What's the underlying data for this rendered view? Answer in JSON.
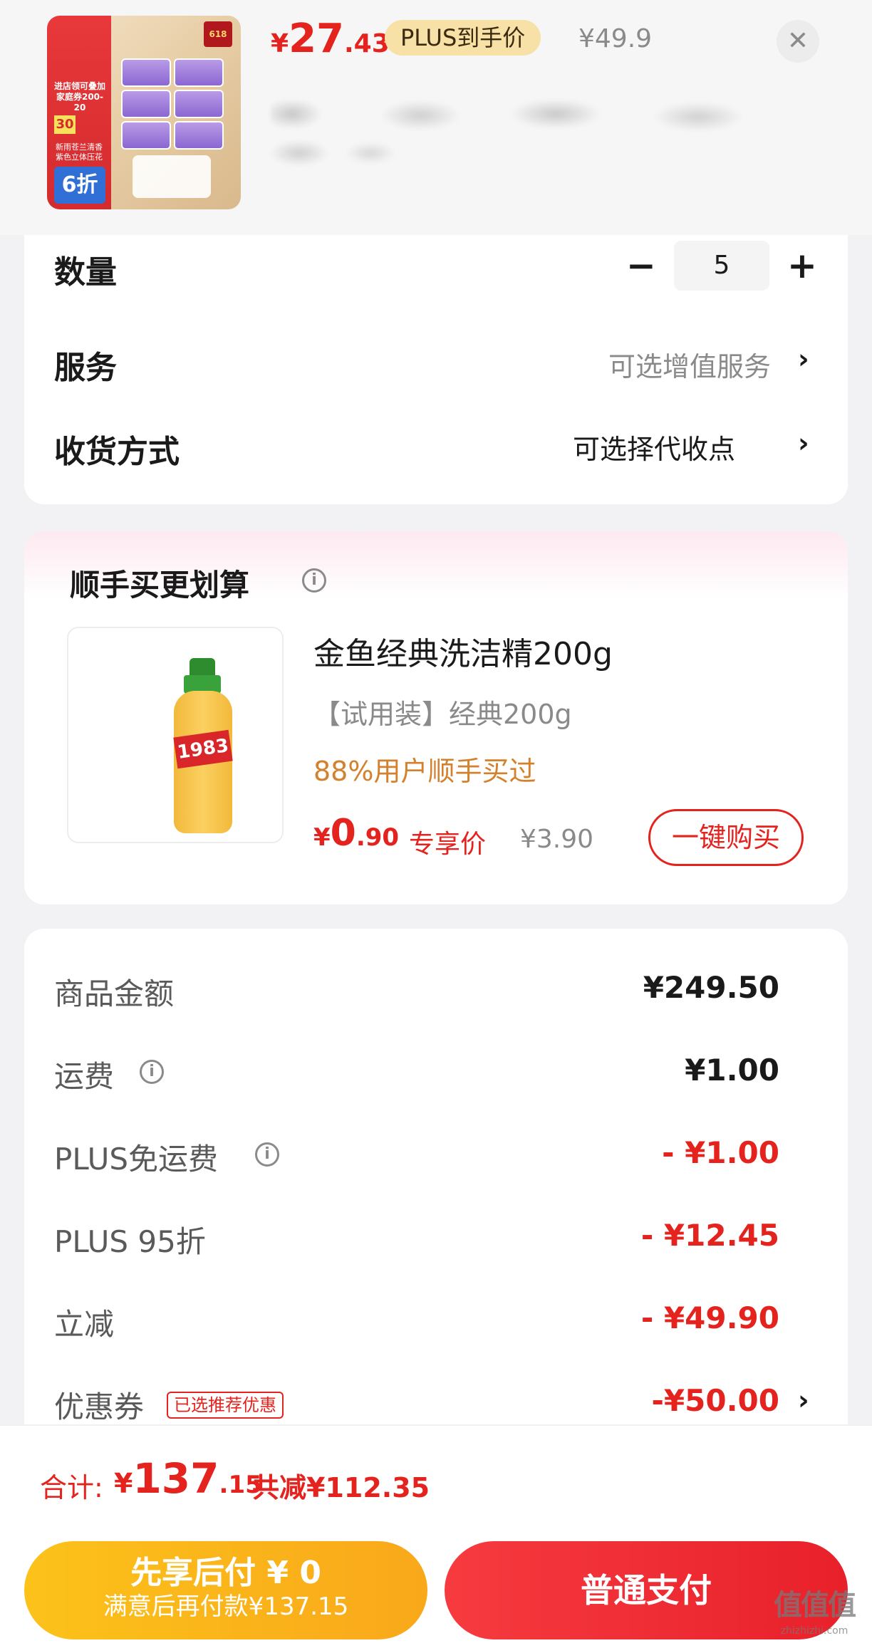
{
  "product": {
    "price_currency": "¥",
    "price_int": "27",
    "price_dec": ".43",
    "plus_badge": "PLUS到手价",
    "original_price": "¥49.9",
    "thumb": {
      "tag_618": "618",
      "promo_text": "进店领可叠加 家庭券200-20",
      "promo_number": "30",
      "promo_sub": "新雨苍兰清香 紫色立体压花",
      "discount": "6折"
    }
  },
  "options": {
    "quantity_label": "数量",
    "quantity_value": "5",
    "minus_symbol": "−",
    "plus_symbol": "+",
    "service_label": "服务",
    "service_value": "可选增值服务",
    "delivery_label": "收货方式",
    "delivery_value": "可选择代收点",
    "chevron": "›"
  },
  "addon": {
    "title": "顺手买更划算",
    "name": "金鱼经典洗洁精200g",
    "spec": "【试用装】经典200g",
    "bought_rate": "88%用户顺手买过",
    "price_currency": "¥",
    "price_int": "0",
    "price_dec": ".90",
    "exclusive_label": "专享价",
    "original_price": "¥3.90",
    "buy_button": "一键购买",
    "bottle_label": "1983"
  },
  "breakdown": {
    "rows": [
      {
        "label": "商品金额",
        "value": "¥249.50",
        "red": false
      },
      {
        "label": "运费",
        "value": "¥1.00",
        "red": false
      },
      {
        "label": "PLUS免运费",
        "value": "- ¥1.00",
        "red": true
      },
      {
        "label": "PLUS 95折",
        "value": "- ¥12.45",
        "red": true
      },
      {
        "label": "立减",
        "value": "- ¥49.90",
        "red": true
      },
      {
        "label": "优惠券",
        "value": "-¥50.00",
        "red": true
      }
    ],
    "coupon_tag": "已选推荐优惠"
  },
  "total": {
    "label": "合计:",
    "currency": "¥",
    "int": "137",
    "dec": ".15",
    "saved": "共减¥112.35"
  },
  "actions": {
    "pay_later_line1": "先享后付 ¥ 0",
    "pay_later_line2": "满意后再付款¥137.15",
    "pay_normal": "普通支付"
  },
  "watermark": {
    "main": "值值值",
    "sub": "zhizhizhi.com"
  },
  "colors": {
    "accent_red": "#e4231e",
    "plus_gold": "#f8e1a6",
    "pay_later_yellow": "#fcc21a",
    "bought_orange": "#d3812d"
  }
}
